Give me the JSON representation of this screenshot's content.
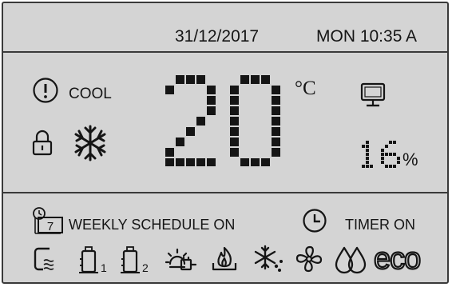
{
  "status_bar": {
    "date": "31/12/2017",
    "clock": "MON 10:35 A"
  },
  "main": {
    "alert_icon": "exclamation-circle-icon",
    "mode_label": "COOL",
    "temperature": "20",
    "temperature_unit": "°C",
    "lock_icon": "padlock-icon",
    "mode_icon": "snowflake-icon",
    "display_icon": "monitor-icon",
    "humidity_value": "16",
    "humidity_unit": "%"
  },
  "schedule": {
    "weekly_label": "WEEKLY SCHEDULE ON",
    "weekly_calendar_day": "7",
    "timer_label": "TIMER ON"
  },
  "function_icons": [
    {
      "name": "wall-unit-icon"
    },
    {
      "name": "tank-1-icon",
      "index": "1"
    },
    {
      "name": "tank-2-icon",
      "index": "2"
    },
    {
      "name": "plug-sun-icon"
    },
    {
      "name": "flame-icon"
    },
    {
      "name": "defrost-icon"
    },
    {
      "name": "fan-icon"
    },
    {
      "name": "drops-icon"
    },
    {
      "name": "eco-icon",
      "text": "eco"
    }
  ],
  "colors": {
    "background": "#d4d4d4",
    "foreground": "#151515"
  }
}
